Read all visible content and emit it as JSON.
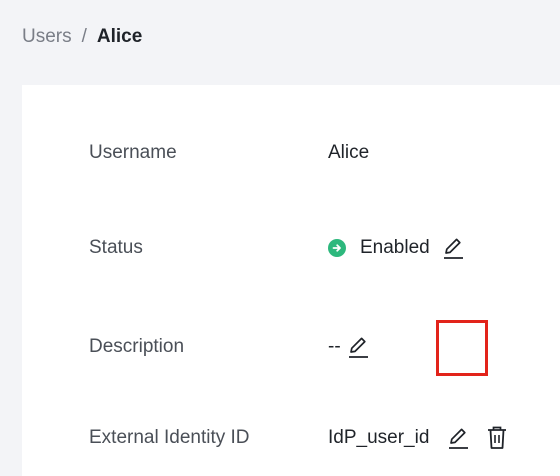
{
  "breadcrumb": {
    "parent": "Users",
    "separator": "/",
    "current": "Alice"
  },
  "fields": {
    "username": {
      "label": "Username",
      "value": "Alice"
    },
    "status": {
      "label": "Status",
      "value": "Enabled",
      "icon": "arrow-right-circle-icon",
      "color": "#2db87d"
    },
    "description": {
      "label": "Description",
      "value": "--"
    },
    "external_identity": {
      "label": "External Identity ID",
      "value": "IdP_user_id"
    }
  },
  "colors": {
    "background": "#f3f4f7",
    "card": "#ffffff",
    "highlight": "#e2231a",
    "text_primary": "#1f2329",
    "text_secondary": "#4a4f57"
  }
}
